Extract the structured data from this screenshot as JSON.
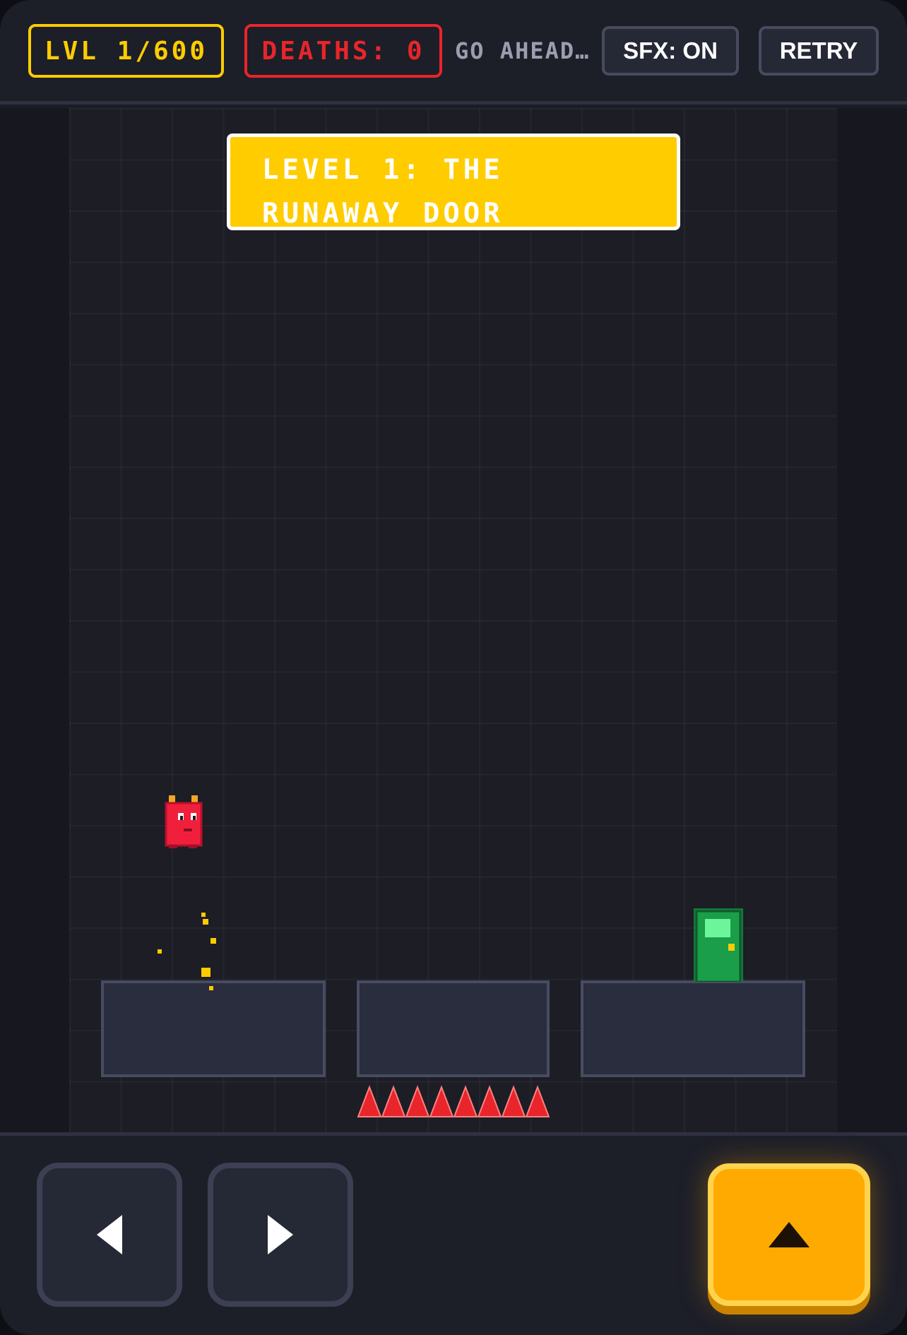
{
  "hud": {
    "level_label": "LVL 1/600",
    "deaths_label": "DEATHS: 0",
    "taunt": "GO AHEAD…",
    "sfx_button": "SFX: ON",
    "retry_button": "RETRY"
  },
  "level": {
    "banner": "LEVEL 1: THE\nRUNAWAY DOOR"
  },
  "controls": {
    "left_icon": "triangle-left-icon",
    "right_icon": "triangle-right-icon",
    "jump_icon": "triangle-up-icon"
  },
  "colors": {
    "accent_yellow": "#ffcc00",
    "danger_red": "#e8252b",
    "door_green": "#1a9e4a",
    "jump_orange": "#ffaa00",
    "player_red": "#f0203c"
  }
}
